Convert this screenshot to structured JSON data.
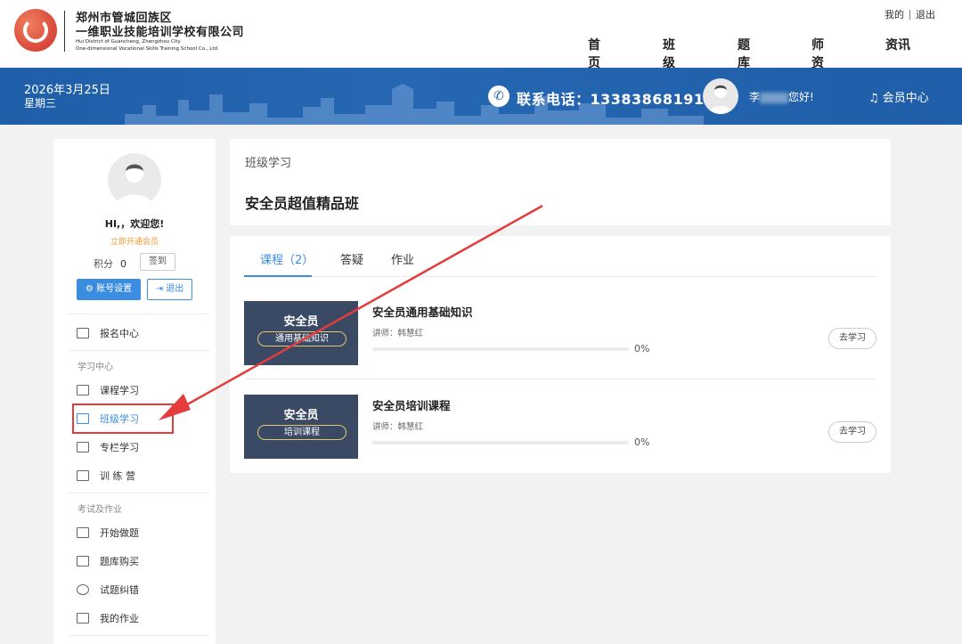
{
  "header": {
    "org_name_line1": "郑州市管城回族区",
    "org_name_line2": "一维职业技能培训学校有限公司",
    "org_en_line1": "Hui District of Guancheng, Zhengzhou City",
    "org_en_line2": "One-dimensional Vocational Skills Training School Co., Ltd.",
    "top_links": {
      "mine": "我的",
      "logout": "退出"
    },
    "nav": {
      "home": "首页",
      "class": "班级",
      "bank": "题库",
      "teachers": "师资",
      "news": "资讯"
    }
  },
  "banner": {
    "date": "2026年3月25日",
    "weekday": "星期三",
    "phone_label": "联系电话：13383868191",
    "greeting_prefix": "李",
    "greeting_suffix": "您好!",
    "member_center": "会员中心"
  },
  "sidebar": {
    "hello": "HI,，欢迎您!",
    "vip_link": "立即开通会员",
    "points_label": "积分",
    "points_value": "0",
    "signin": "签到",
    "account_settings": "账号设置",
    "logout": "退出",
    "item_register": "报名中心",
    "group_study": "学习中心",
    "item_course_study": "课程学习",
    "item_class_study": "班级学习",
    "item_column_study": "专栏学习",
    "item_camp": "训 练 营",
    "group_exam": "考试及作业",
    "item_start_quiz": "开始做题",
    "item_buy_bank": "题库购买",
    "item_mistakes": "试题纠错",
    "item_homework": "我的作业"
  },
  "main": {
    "breadcrumb": "班级学习",
    "class_title": "安全员超值精品班",
    "tabs": {
      "courses": "课程（2）",
      "qa": "答疑",
      "homework": "作业"
    },
    "courses": [
      {
        "thumb_title": "安全员",
        "thumb_pill": "通用基础知识",
        "name": "安全员通用基础知识",
        "teacher": "讲师：韩慧红",
        "progress": "0%",
        "button": "去学习"
      },
      {
        "thumb_title": "安全员",
        "thumb_pill": "培训课程",
        "name": "安全员培训课程",
        "teacher": "讲师：韩慧红",
        "progress": "0%",
        "button": "去学习"
      }
    ]
  },
  "colors": {
    "brand_blue": "#1f5ea8",
    "accent_blue": "#3a8de0",
    "annotation_red": "#e43b3b",
    "vip_orange": "#f29b3a"
  }
}
